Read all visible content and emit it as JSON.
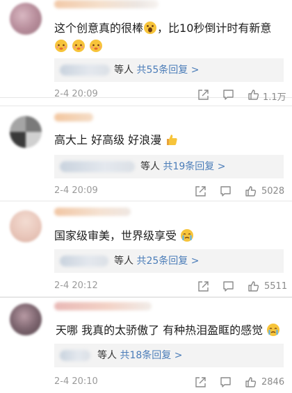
{
  "comments": [
    {
      "text": "这个创意真的很棒",
      "text2": "，比10秒倒计时有新意",
      "replies_who": "等人",
      "replies_link": "共55条回复 >",
      "time": "2-4 20:09",
      "likes": "1.1万"
    },
    {
      "text": "高大上  好高级  好浪漫",
      "replies_who": "等人",
      "replies_link": "共19条回复 >",
      "time": "2-4 20:09",
      "likes": "5028"
    },
    {
      "text": "国家级审美，世界级享受",
      "replies_who": "等人",
      "replies_link": "共25条回复 >",
      "time": "2-4 20:12",
      "likes": "5511"
    },
    {
      "text": "天哪  我真的太骄傲了  有种热泪盈眶的感觉",
      "replies_who": "等人",
      "replies_link": "共18条回复 >",
      "time": "2-4 20:10",
      "likes": "2846"
    }
  ],
  "icons": {
    "share": "share-icon",
    "comment": "comment-icon",
    "like": "thumbs-up-icon"
  },
  "colors": {
    "link": "#4a7cb8",
    "reply_bg": "#f3f3f3",
    "muted": "#9a9a9a"
  }
}
